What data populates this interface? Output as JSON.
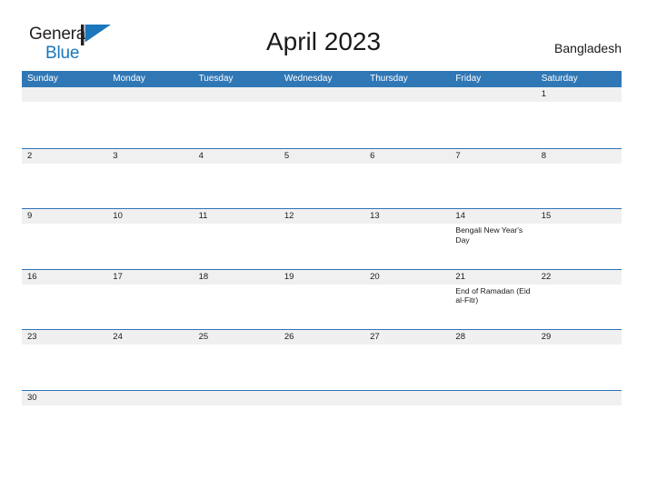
{
  "brand": {
    "name_part1": "General",
    "name_part2": "Blue",
    "flag_icon": "triangle-flag-icon",
    "accent_color": "#1b76bc"
  },
  "header": {
    "title": "April 2023",
    "region": "Bangladesh"
  },
  "theme": {
    "header_blue": "#3077b5",
    "rule_blue": "#2e74b5",
    "date_band_gray": "#f0f0f0",
    "text_color": "#1a1a1a"
  },
  "calendar": {
    "weekdays": [
      "Sunday",
      "Monday",
      "Tuesday",
      "Wednesday",
      "Thursday",
      "Friday",
      "Saturday"
    ],
    "weeks": [
      {
        "days": [
          {
            "date": "",
            "events": []
          },
          {
            "date": "",
            "events": []
          },
          {
            "date": "",
            "events": []
          },
          {
            "date": "",
            "events": []
          },
          {
            "date": "",
            "events": []
          },
          {
            "date": "",
            "events": []
          },
          {
            "date": "1",
            "events": []
          }
        ]
      },
      {
        "days": [
          {
            "date": "2",
            "events": []
          },
          {
            "date": "3",
            "events": []
          },
          {
            "date": "4",
            "events": []
          },
          {
            "date": "5",
            "events": []
          },
          {
            "date": "6",
            "events": []
          },
          {
            "date": "7",
            "events": []
          },
          {
            "date": "8",
            "events": []
          }
        ]
      },
      {
        "days": [
          {
            "date": "9",
            "events": []
          },
          {
            "date": "10",
            "events": []
          },
          {
            "date": "11",
            "events": []
          },
          {
            "date": "12",
            "events": []
          },
          {
            "date": "13",
            "events": []
          },
          {
            "date": "14",
            "events": [
              "Bengali New Year's Day"
            ]
          },
          {
            "date": "15",
            "events": []
          }
        ]
      },
      {
        "days": [
          {
            "date": "16",
            "events": []
          },
          {
            "date": "17",
            "events": []
          },
          {
            "date": "18",
            "events": []
          },
          {
            "date": "19",
            "events": []
          },
          {
            "date": "20",
            "events": []
          },
          {
            "date": "21",
            "events": [
              "End of Ramadan (Eid al-Fitr)"
            ]
          },
          {
            "date": "22",
            "events": []
          }
        ]
      },
      {
        "days": [
          {
            "date": "23",
            "events": []
          },
          {
            "date": "24",
            "events": []
          },
          {
            "date": "25",
            "events": []
          },
          {
            "date": "26",
            "events": []
          },
          {
            "date": "27",
            "events": []
          },
          {
            "date": "28",
            "events": []
          },
          {
            "date": "29",
            "events": []
          }
        ]
      },
      {
        "days": [
          {
            "date": "30",
            "events": []
          },
          {
            "date": "",
            "events": []
          },
          {
            "date": "",
            "events": []
          },
          {
            "date": "",
            "events": []
          },
          {
            "date": "",
            "events": []
          },
          {
            "date": "",
            "events": []
          },
          {
            "date": "",
            "events": []
          }
        ]
      }
    ]
  }
}
